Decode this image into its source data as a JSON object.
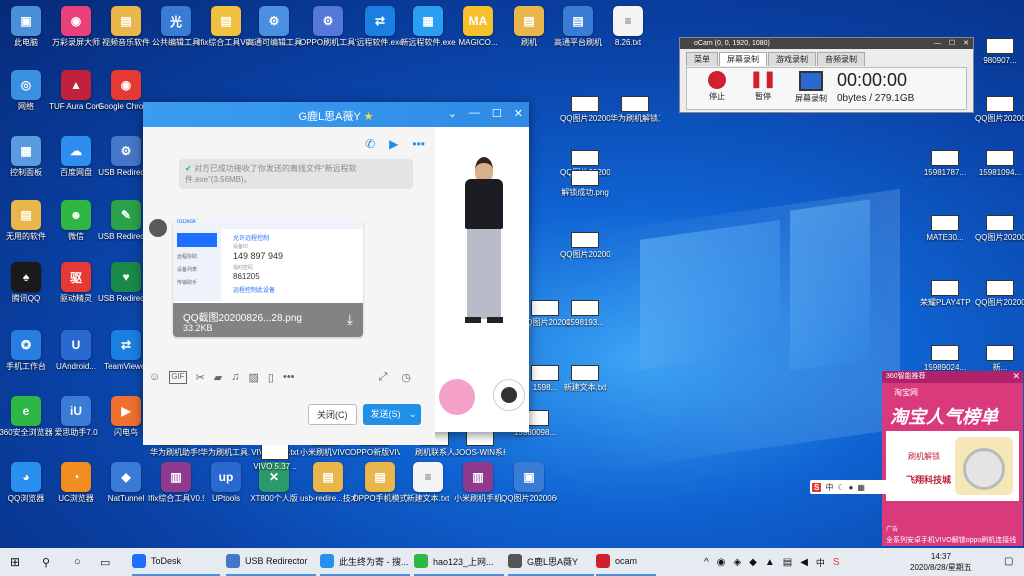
{
  "desktop": {
    "icons": [
      {
        "label": "此电脑",
        "color": "#4a90d9",
        "glyph": "▣"
      },
      {
        "label": "万彩录屏大师",
        "color": "#e9407b",
        "glyph": "◉"
      },
      {
        "label": "视频音乐软件",
        "color": "#e8b64a",
        "glyph": "▤"
      },
      {
        "label": "公共编辑工具",
        "color": "#3a7bd5",
        "glyph": "光"
      },
      {
        "label": "Ifix综合工具V0.0.9",
        "color": "#f0c040",
        "glyph": "▤"
      },
      {
        "label": "高通可编辑工具V2.8",
        "color": "#4a8fe0",
        "glyph": "⚙"
      },
      {
        "label": "OPPO刷机工具V2.8",
        "color": "#5578d8",
        "glyph": "⚙"
      },
      {
        "label": "远程软件.exe",
        "color": "#1a7fe0",
        "glyph": "⇄"
      },
      {
        "label": "新远程软件.exe",
        "color": "#2a9ef0",
        "glyph": "▦"
      },
      {
        "label": "MAGICO...",
        "color": "#f5c02a",
        "glyph": "MA"
      },
      {
        "label": "刷机",
        "color": "#e8b64a",
        "glyph": "▤"
      },
      {
        "label": "高通平台刷机",
        "color": "#3a7bd5",
        "glyph": "▤"
      },
      {
        "label": "8.26.txt",
        "color": "#f4f4f4",
        "glyph": "≡"
      },
      {
        "label": "网络",
        "color": "#3a90e0",
        "glyph": "◎"
      },
      {
        "label": "TUF Aura Core",
        "color": "#c0213b",
        "glyph": "▲"
      },
      {
        "label": "Google Chrome",
        "color": "#e53935",
        "glyph": "◉"
      },
      {
        "label": "控制面板",
        "color": "#5a9be0",
        "glyph": "▦"
      },
      {
        "label": "百度网盘",
        "color": "#2d8ef0",
        "glyph": "☁"
      },
      {
        "label": "USB Redirector",
        "color": "#4676c8",
        "glyph": "⚙"
      },
      {
        "label": "无用的软件",
        "color": "#e8b64a",
        "glyph": "▤"
      },
      {
        "label": "微信",
        "color": "#2fb745",
        "glyph": "☻"
      },
      {
        "label": "USB Redirecto...",
        "color": "#2aa14a",
        "glyph": "✎"
      },
      {
        "label": "腾讯QQ",
        "color": "#1a1a1a",
        "glyph": "♠"
      },
      {
        "label": "驱动精灵",
        "color": "#e53935",
        "glyph": "驱"
      },
      {
        "label": "USB Redirecto...",
        "color": "#1a8a4a",
        "glyph": "♥"
      },
      {
        "label": "手机工作台",
        "color": "#2a7de0",
        "glyph": "✪"
      },
      {
        "label": "UAndroid...",
        "color": "#2a6ad0",
        "glyph": "U"
      },
      {
        "label": "TeamViewer",
        "color": "#1a7fe0",
        "glyph": "⇄"
      },
      {
        "label": "360安全浏览器",
        "color": "#2fb745",
        "glyph": "e"
      },
      {
        "label": "爱思助手7.0",
        "color": "#3a7bd5",
        "glyph": "iU"
      },
      {
        "label": "闪电鸟",
        "color": "#ef7030",
        "glyph": "▶"
      },
      {
        "label": "QQ浏览器",
        "color": "#2a90f0",
        "glyph": "◕"
      },
      {
        "label": "UC浏览器",
        "color": "#f08c20",
        "glyph": "◔"
      },
      {
        "label": "NatTunnel",
        "color": "#3a7bd5",
        "glyph": "◆"
      },
      {
        "label": "Ifix综合工具V0.9.rar",
        "color": "#8e3a8e",
        "glyph": "▥"
      },
      {
        "label": "UPtools",
        "color": "#2a6ad0",
        "glyph": "up"
      },
      {
        "label": "XT800个人版",
        "color": "#2a9a6a",
        "glyph": "✕"
      },
      {
        "label": "usb-redire...技术员",
        "color": "#e8b64a",
        "glyph": "▤"
      },
      {
        "label": "OPPO手机模式",
        "color": "#e8b64a",
        "glyph": "▤"
      },
      {
        "label": "新建文本.txt",
        "color": "#f4f4f4",
        "glyph": "≡"
      },
      {
        "label": "小米刷机手机",
        "color": "#8e3a8e",
        "glyph": "▥"
      },
      {
        "label": "QQ图片20200609...",
        "color": "#3a7bd5",
        "glyph": "▣"
      }
    ],
    "right_labels": [
      "980907...",
      "QQ图片20200822...",
      "15981787...",
      "15981094...",
      "MATE30...",
      "QQ图片20200822...",
      "荣耀PLAY4TPR...",
      "QQ图片20200822...",
      "15989024...",
      "新...",
      "QQ图片20200815...",
      "华为刷机解锁工具.rar",
      "QQ图片20200822...",
      "解锁成功.png",
      "1598193...",
      "QQ图片20200823...",
      "QQ图片20200821...",
      "新建文本.txt",
      "15980098...",
      "华为刷机工具.rar",
      "华为刷机助手5.5",
      "VIVO 8.37.txt",
      "小米刷机VIVO工具",
      "刷机联系人",
      "OPPO新版VIVO",
      "1598...",
      "VIVO 5.37 ..",
      "JOOS-WIN系统"
    ]
  },
  "chat": {
    "title": "G鹿L思A薇Y",
    "star": "★",
    "system_message": "对方已成功接收了你发送的离线文件“新远程软件.exe”(3.56MB)。",
    "image_card": {
      "app": "ToDesk",
      "heading": "允许远程控制",
      "device_id_label": "设备ID",
      "device_id": "149 897 949",
      "password_label": "临时密码",
      "password": "861205",
      "remote_label": "远程控制此设备",
      "menu": [
        "远程协助",
        "设备列表",
        "传输助手"
      ],
      "file_name": "QQ截图20200826...28.png",
      "file_size": "33.2KB"
    },
    "close_button": "关闭(C)",
    "send_button": "发送(S)",
    "header_icons": [
      "phone-icon",
      "video-icon",
      "more-icon"
    ],
    "toolbar_icons": [
      "emoji-icon",
      "gif-icon",
      "scissors-icon",
      "folder-icon",
      "music-icon",
      "image-icon",
      "phone-mirror-icon",
      "more-icon"
    ]
  },
  "ocam": {
    "title": "oCam (0, 0, 1920, 1080)",
    "tabs": [
      "菜单",
      "屏幕录制",
      "游戏录制",
      "音频录制"
    ],
    "stop_label": "停止",
    "pause_label": "暂停",
    "screen_label": "屏幕录制",
    "timer": "00:00:00",
    "bytes": "0bytes / 279.1GB"
  },
  "ad": {
    "top_text": "360智能推荐",
    "site": "淘宝网",
    "headline": "淘宝人气榜单",
    "badge": "刷机解锁",
    "brand": "飞翔科技城",
    "footer": "全系列安卓手机VIVO解锁oppo刷机连接线",
    "ad_label": "广告"
  },
  "taskbar": {
    "items": [
      {
        "label": "ToDesk",
        "color": "#1e6fff"
      },
      {
        "label": "USB Redirector",
        "color": "#4676c8"
      },
      {
        "label": "此生终为寄 - 搜...",
        "color": "#2a90f0"
      },
      {
        "label": "hao123_上网...",
        "color": "#2fb745"
      },
      {
        "label": "G鹿L思A薇Y",
        "color": "#555"
      },
      {
        "label": "ocam",
        "color": "#d02030"
      }
    ],
    "ime": "中",
    "time": "14:37",
    "date": "2020/8/28/星期五"
  }
}
